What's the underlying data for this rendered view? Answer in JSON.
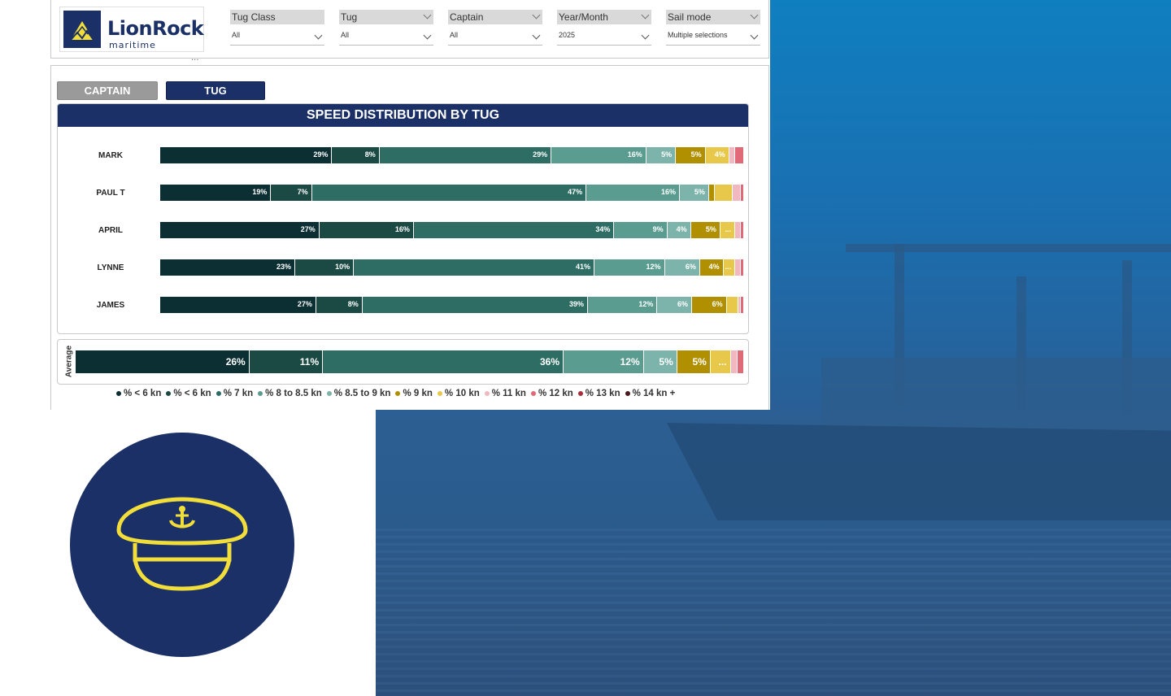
{
  "brand": {
    "name": "LionRock",
    "sub": "maritime",
    "more": "...",
    "navy": "#1b3066",
    "yellow": "#f2de3a"
  },
  "filters": [
    {
      "label": "Tug Class",
      "value": "All"
    },
    {
      "label": "Tug",
      "value": "All"
    },
    {
      "label": "Captain",
      "value": "All"
    },
    {
      "label": "Year/Month",
      "value": "2025"
    },
    {
      "label": "Sail mode",
      "value": "Multiple selections"
    }
  ],
  "toggles": {
    "captain": "CAPTAIN",
    "tug": "TUG",
    "active": "TUG"
  },
  "chart_data": {
    "type": "bar",
    "orientation": "horizontal",
    "stacked": "percent",
    "title": "SPEED DISTRIBUTION BY TUG",
    "categories": [
      "MARK",
      "PAUL T",
      "APRIL",
      "LYNNE",
      "JAMES"
    ],
    "series": [
      {
        "name": "% < 6 kn",
        "color": "#0c2f33",
        "values": [
          29,
          19,
          27,
          23,
          27
        ]
      },
      {
        "name": "% < 6 kn",
        "color": "#1b4a45",
        "values": [
          8,
          7,
          16,
          10,
          8
        ]
      },
      {
        "name": "% 7 kn",
        "color": "#2d6d63",
        "values": [
          29,
          47,
          34,
          41,
          39
        ]
      },
      {
        "name": "% 8 to 8.5 kn",
        "color": "#5a9c90",
        "values": [
          16,
          16,
          9,
          12,
          12
        ]
      },
      {
        "name": "% 8.5 to 9 kn",
        "color": "#7cb3aa",
        "values": [
          5,
          5,
          4,
          6,
          6
        ]
      },
      {
        "name": "% 9 kn",
        "color": "#b09000",
        "values": [
          5,
          1,
          5,
          4,
          6
        ]
      },
      {
        "name": "% 10 kn",
        "color": "#e8c84a",
        "values": [
          4,
          3,
          2.5,
          2,
          2
        ]
      },
      {
        "name": "% 11 kn",
        "color": "#f2b8c0",
        "values": [
          1,
          1.5,
          1,
          1,
          0.5
        ]
      },
      {
        "name": "% 12 kn",
        "color": "#e06a78",
        "values": [
          1.5,
          0.5,
          0.5,
          0.5,
          0.5
        ]
      },
      {
        "name": "% 13 kn",
        "color": "#a82f3a",
        "values": [
          0,
          0,
          0,
          0,
          0
        ]
      },
      {
        "name": "% 14 kn +",
        "color": "#4a1a1a",
        "values": [
          0,
          0,
          0,
          0,
          0
        ]
      }
    ],
    "segment_labels": [
      [
        "29%",
        "8%",
        "29%",
        "16%",
        "5%",
        "5%",
        "4%",
        "",
        "",
        "",
        ""
      ],
      [
        "19%",
        "7%",
        "47%",
        "16%",
        "5%",
        "",
        "",
        "",
        "",
        "",
        ""
      ],
      [
        "27%",
        "16%",
        "34%",
        "9%",
        "4%",
        "5%",
        "...",
        "",
        "",
        "",
        ""
      ],
      [
        "23%",
        "10%",
        "41%",
        "12%",
        "6%",
        "4%",
        "...",
        "",
        "",
        "",
        ""
      ],
      [
        "27%",
        "8%",
        "39%",
        "12%",
        "6%",
        "6%",
        "",
        "",
        "",
        "",
        ""
      ]
    ],
    "average": {
      "label": "Average",
      "values": [
        26,
        11,
        36,
        12,
        5,
        5,
        3,
        1,
        1,
        0,
        0
      ],
      "labels": [
        "26%",
        "11%",
        "36%",
        "12%",
        "5%",
        "5%",
        "...",
        "",
        "",
        "",
        ""
      ]
    },
    "legend": [
      {
        "name": "% < 6 kn",
        "color": "#0c2f33"
      },
      {
        "name": "% < 6 kn",
        "color": "#1b4a45"
      },
      {
        "name": "% 7 kn",
        "color": "#2d6d63"
      },
      {
        "name": "% 8 to 8.5 kn",
        "color": "#5a9c90"
      },
      {
        "name": "% 8.5 to 9 kn",
        "color": "#7cb3aa"
      },
      {
        "name": "% 9 kn",
        "color": "#b09000"
      },
      {
        "name": "% 10 kn",
        "color": "#e8c84a"
      },
      {
        "name": "% 11 kn",
        "color": "#f2b8c0"
      },
      {
        "name": "% 12 kn",
        "color": "#e06a78"
      },
      {
        "name": "% 13 kn",
        "color": "#a82f3a"
      },
      {
        "name": "% 14 kn +",
        "color": "#4a1a1a"
      }
    ]
  }
}
